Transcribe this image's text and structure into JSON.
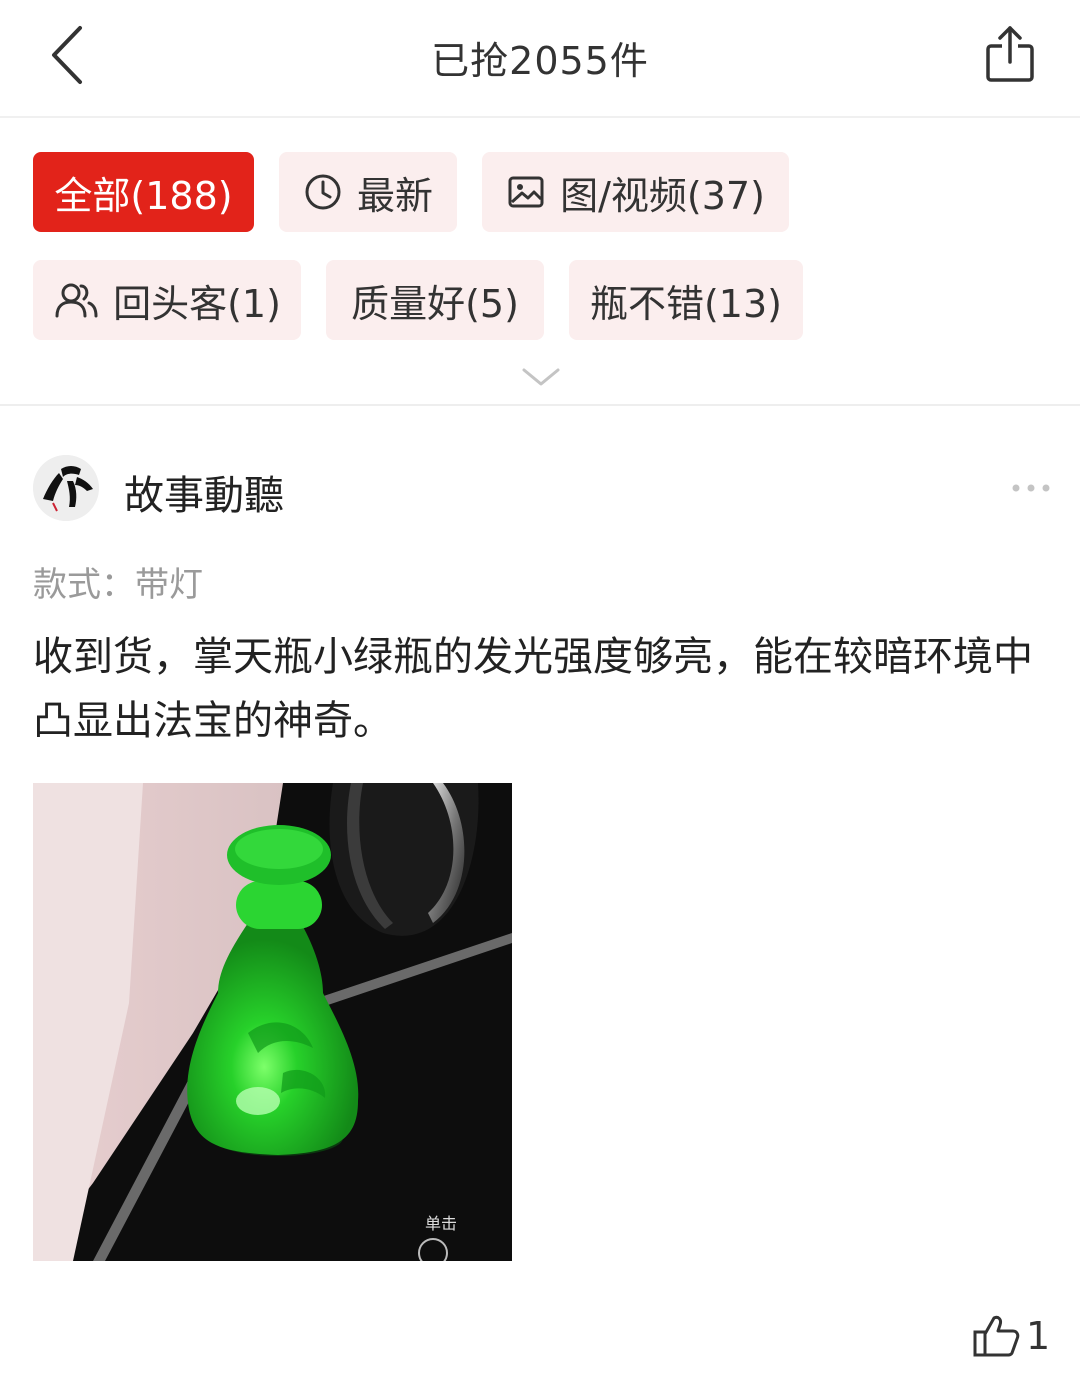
{
  "header": {
    "title": "已抢2055件"
  },
  "filters": {
    "all": "全部(188)",
    "latest": "最新",
    "media": "图/视频(37)",
    "returning": "回头客(1)",
    "quality": "质量好(5)",
    "bottle": "瓶不错(13)"
  },
  "review": {
    "username": "故事動聽",
    "style": "款式：带灯",
    "text": "收到货，掌天瓶小绿瓶的发光强度够亮，能在较暗环境中凸显出法宝的神奇。",
    "like_count": "1"
  },
  "colors": {
    "accent": "#e2231a",
    "chip_bg": "#fbeeee"
  },
  "icons": [
    "back-arrow-icon",
    "share-icon",
    "clock-icon",
    "image-icon",
    "users-icon",
    "chevron-down-icon",
    "more-icon",
    "thumbs-up-icon"
  ]
}
